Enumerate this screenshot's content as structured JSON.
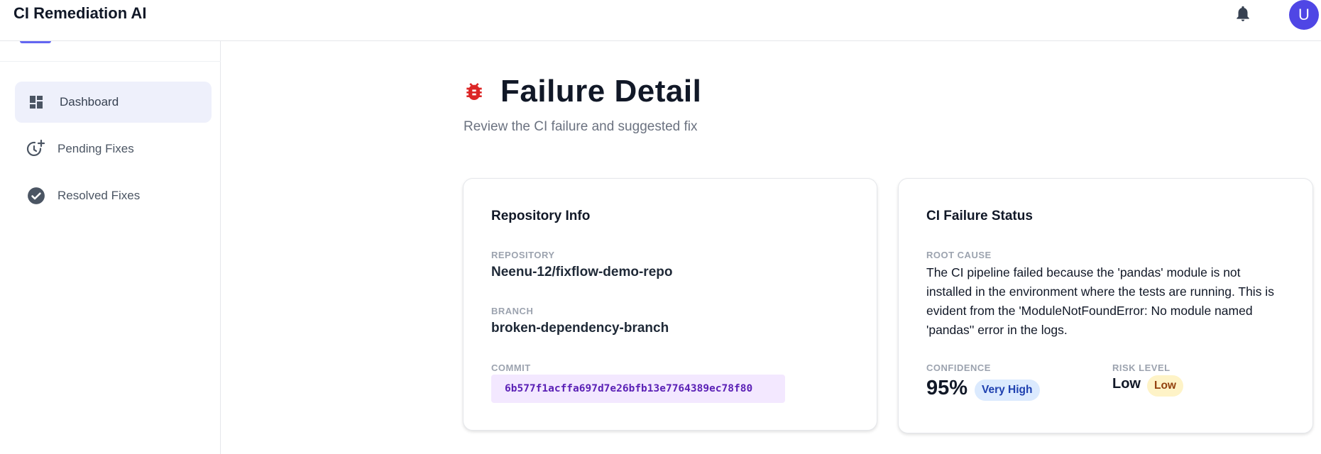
{
  "app": {
    "title": "CI Remediation AI"
  },
  "header": {
    "avatar_letter": "U",
    "notification_icon": "bell-icon"
  },
  "sidebar": {
    "items": [
      {
        "label": "Dashboard",
        "icon": "dashboard-icon",
        "active": true
      },
      {
        "label": "Pending Fixes",
        "icon": "clock-plus-icon",
        "active": false
      },
      {
        "label": "Resolved Fixes",
        "icon": "check-circle-icon",
        "active": false
      }
    ]
  },
  "page": {
    "icon": "bug-icon",
    "title": "Failure Detail",
    "subtitle": "Review the CI failure and suggested fix"
  },
  "repo_card": {
    "title": "Repository Info",
    "repository_label": "REPOSITORY",
    "repository": "Neenu-12/fixflow-demo-repo",
    "branch_label": "BRANCH",
    "branch": "broken-dependency-branch",
    "commit_label": "COMMIT",
    "commit": "6b577f1acffa697d7e26bfb13e7764389ec78f80"
  },
  "status_card": {
    "title": "CI Failure Status",
    "root_cause_label": "ROOT CAUSE",
    "root_cause": "The CI pipeline failed because the 'pandas' module is not installed in the environment where the tests are running. This is evident from the 'ModuleNotFoundError: No module named 'pandas'' error in the logs.",
    "confidence_label": "CONFIDENCE",
    "confidence": "95%",
    "confidence_badge": "Very High",
    "risk_label": "RISK LEVEL",
    "risk": "Low",
    "risk_badge": "Low"
  },
  "colors": {
    "accent": "#4f46e5",
    "bug_red": "#dc2626",
    "commit_bg": "#f3e8ff",
    "commit_text": "#5b21b6",
    "very_high_bg": "#dbeafe",
    "low_bg": "#fef3c7"
  }
}
